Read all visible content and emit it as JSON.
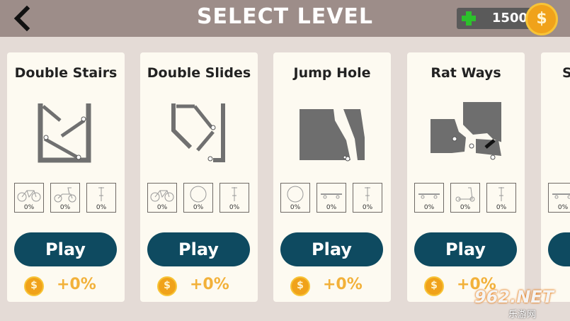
{
  "header": {
    "title": "SELECT LEVEL",
    "coins": "1500",
    "coin_symbol": "$"
  },
  "levels": [
    {
      "name": "Double Stairs",
      "play_label": "Play",
      "reward": "+0%",
      "coin_symbol": "$",
      "vehicles": [
        {
          "icon": "bicycle-icon",
          "progress": "0%"
        },
        {
          "icon": "scooter-icon",
          "progress": "0%"
        },
        {
          "icon": "pogo-stick-icon",
          "progress": "0%"
        }
      ]
    },
    {
      "name": "Double Slides",
      "play_label": "Play",
      "reward": "+0%",
      "coin_symbol": "$",
      "vehicles": [
        {
          "icon": "bicycle-icon",
          "progress": "0%"
        },
        {
          "icon": "ball-icon",
          "progress": "0%"
        },
        {
          "icon": "pogo-stick-icon",
          "progress": "0%"
        }
      ]
    },
    {
      "name": "Jump Hole",
      "play_label": "Play",
      "reward": "+0%",
      "coin_symbol": "$",
      "vehicles": [
        {
          "icon": "ball-icon",
          "progress": "0%"
        },
        {
          "icon": "skateboard-icon",
          "progress": "0%"
        },
        {
          "icon": "pogo-stick-icon",
          "progress": "0%"
        }
      ]
    },
    {
      "name": "Rat Ways",
      "play_label": "Play",
      "reward": "+0%",
      "coin_symbol": "$",
      "vehicles": [
        {
          "icon": "skateboard-icon",
          "progress": "0%"
        },
        {
          "icon": "kick-scooter-icon",
          "progress": "0%"
        },
        {
          "icon": "pogo-stick-icon",
          "progress": "0%"
        }
      ]
    },
    {
      "name": "S",
      "vehicles": [
        {
          "icon": "skateboard-icon",
          "progress": "0%"
        }
      ]
    }
  ],
  "watermark": {
    "line1": "962.NET",
    "line2": "乐游网"
  },
  "colors": {
    "topbar": "#9d8d89",
    "background": "#e4dbd6",
    "card": "#fdfaf1",
    "play_button": "#0e4a60",
    "reward_text": "#f2b13a",
    "coin": "#f0a21a",
    "plus": "#2cc12c"
  }
}
